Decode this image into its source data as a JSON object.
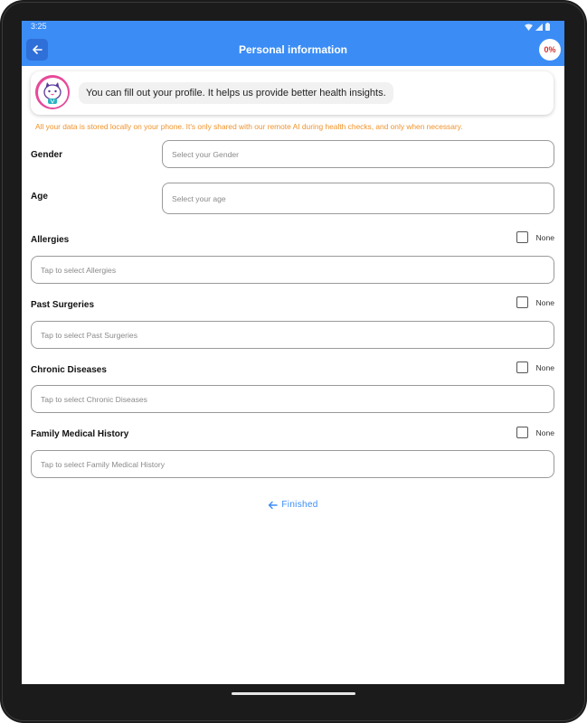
{
  "status_bar": {
    "time": "3:25"
  },
  "header": {
    "title": "Personal information",
    "progress": "0%"
  },
  "assistant": {
    "message": "You can fill out your profile. It helps us provide better health insights."
  },
  "privacy_note": "All your data is stored locally on your phone. It's only shared with our remote AI during health checks, and only when necessary.",
  "fields": {
    "gender": {
      "label": "Gender",
      "placeholder": "Select your Gender"
    },
    "age": {
      "label": "Age",
      "placeholder": "Select your age"
    },
    "allergies": {
      "label": "Allergies",
      "placeholder": "Tap to select Allergies",
      "none_label": "None"
    },
    "past_surgeries": {
      "label": "Past Surgeries",
      "placeholder": "Tap to select Past Surgeries",
      "none_label": "None"
    },
    "chronic_diseases": {
      "label": "Chronic Diseases",
      "placeholder": "Tap to select Chronic Diseases",
      "none_label": "None"
    },
    "family_history": {
      "label": "Family Medical History",
      "placeholder": "Tap to select Family Medical History",
      "none_label": "None"
    }
  },
  "finish": {
    "label": "Finished",
    "icon": "arrow-left-icon"
  },
  "colors": {
    "accent": "#3b8cf5",
    "warning": "#f0932b",
    "progress": "#d32f2f",
    "avatar_ring": "#e64a9a"
  }
}
